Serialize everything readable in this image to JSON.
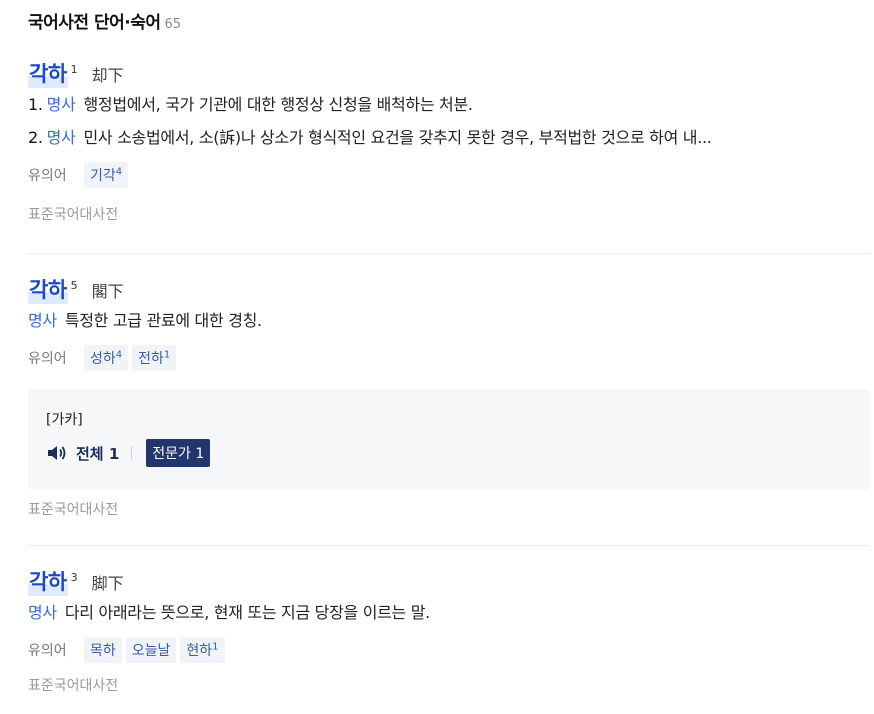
{
  "section": {
    "title": "국어사전 단어·숙어",
    "count": "65"
  },
  "entries": [
    {
      "headword": "각하",
      "homograph": "1",
      "hanja": "却下",
      "senses": [
        {
          "num": "1.",
          "pos": "명사",
          "text": "행정법에서, 국가 기관에 대한 행정상 신청을 배척하는 처분."
        },
        {
          "num": "2.",
          "pos": "명사",
          "text": "민사 소송법에서, 소(訴)나 상소가 형식적인 요건을 갖추지 못한 경우, 부적법한 것으로 하여 내..."
        }
      ],
      "synonym_label": "유의어",
      "synonyms": [
        {
          "word": "기각",
          "sup": "4"
        }
      ],
      "source": "표준국어대사전"
    },
    {
      "headword": "각하",
      "homograph": "5",
      "hanja": "閣下",
      "senses": [
        {
          "num": "",
          "pos": "명사",
          "text": "특정한 고급 관료에 대한 경칭."
        }
      ],
      "synonym_label": "유의어",
      "synonyms": [
        {
          "word": "성하",
          "sup": "4"
        },
        {
          "word": "전하",
          "sup": "1"
        }
      ],
      "media": {
        "title": "[가카]",
        "all_label": "전체 1",
        "expert_label": "전문가 1"
      },
      "source": "표준국어대사전"
    },
    {
      "headword": "각하",
      "homograph": "3",
      "hanja": "脚下",
      "senses": [
        {
          "num": "",
          "pos": "명사",
          "text": "다리 아래라는 뜻으로, 현재 또는 지금 당장을 이르는 말."
        }
      ],
      "synonym_label": "유의어",
      "synonyms": [
        {
          "word": "목하",
          "sup": ""
        },
        {
          "word": "오늘날",
          "sup": ""
        },
        {
          "word": "현하",
          "sup": "1"
        }
      ],
      "source": "표준국어대사전"
    }
  ],
  "colors": {
    "headword": "#1a49c4",
    "pos": "#3a6cc8",
    "expert_badge": "#22356e"
  },
  "icons": {
    "media": "speaker-icon"
  }
}
